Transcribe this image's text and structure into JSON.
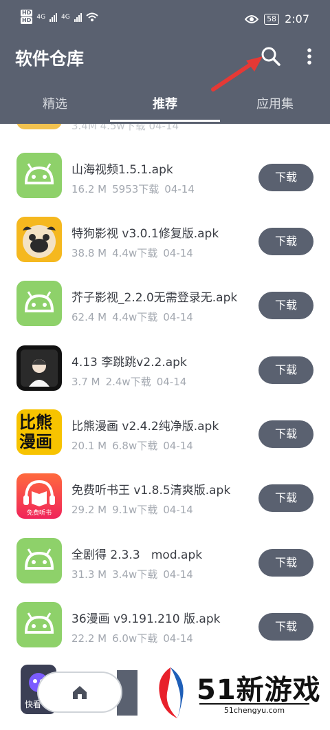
{
  "status_bar": {
    "hd1": "HD",
    "hd2": "HD",
    "net1": "4G",
    "net2": "4G",
    "battery": "58",
    "time": "2:07"
  },
  "app_bar": {
    "title": "软件仓库"
  },
  "tabs": [
    {
      "label": "精选"
    },
    {
      "label": "推荐"
    },
    {
      "label": "应用集"
    }
  ],
  "peek_row_meta": "3.4M 4.5w下载 04-14",
  "apps": [
    {
      "name": "山海视频1.5.1.apk",
      "size": "16.2 M",
      "downloads": "5953下载",
      "date": "04-14",
      "icon": "android-icon",
      "button": "下载"
    },
    {
      "name": "特狗影视 v3.0.1修复版.apk",
      "size": "38.8 M",
      "downloads": "4.4w下载",
      "date": "04-14",
      "icon": "pug-icon",
      "button": "下载"
    },
    {
      "name": "芥子影视_2.2.0无需登录无.apk",
      "size": "62.4 M",
      "downloads": "4.4w下载",
      "date": "04-14",
      "icon": "android-icon",
      "button": "下载"
    },
    {
      "name": "4.13 李跳跳v2.2.apk",
      "size": "3.7 M",
      "downloads": "2.4w下载",
      "date": "04-14",
      "icon": "portrait-icon",
      "button": "下载"
    },
    {
      "name": "比熊漫画 v2.4.2纯净版.apk",
      "size": "20.1 M",
      "downloads": "6.8w下载",
      "date": "04-14",
      "icon": "bixiong-comic-icon",
      "icon_text1": "比熊",
      "icon_text2": "漫画",
      "button": "下载"
    },
    {
      "name": "免费听书王 v1.8.5清爽版.apk",
      "size": "29.2 M",
      "downloads": "9.1w下载",
      "date": "04-14",
      "icon": "audiobook-icon",
      "icon_text": "免费听书",
      "button": "下载"
    },
    {
      "name": "全剧得 2.3.3   mod.apk",
      "size": "31.3 M",
      "downloads": "3.4w下载",
      "date": "04-14",
      "icon": "android-icon",
      "button": "下载"
    },
    {
      "name": "36漫画 v9.191.210 版.apk",
      "size": "22.2 M",
      "downloads": "6.0w下载",
      "date": "04-14",
      "icon": "android-icon",
      "button": "下载"
    }
  ],
  "bottom": {
    "app_label": "快看",
    "watermark_text": "51新游戏",
    "watermark_url": "51chengyu.com"
  },
  "colors": {
    "primary": "#5a6170",
    "android_green": "#8ed16a",
    "arrow_red": "#e53935"
  }
}
